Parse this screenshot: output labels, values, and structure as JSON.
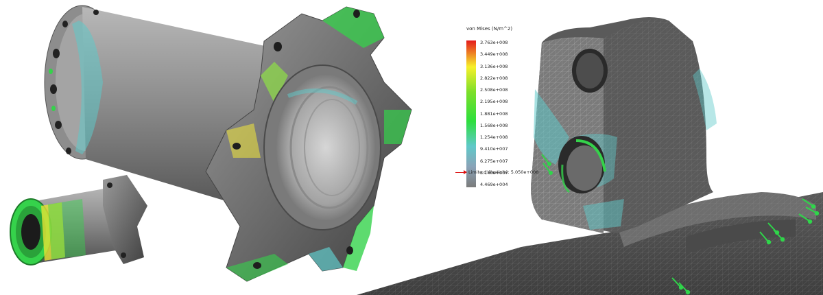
{
  "legend": {
    "title": "von Mises (N/m^2)",
    "ticks": [
      "3.763e+008",
      "3.449e+008",
      "3.136e+008",
      "2.822e+008",
      "2.508e+008",
      "2.195e+008",
      "1.881e+008",
      "1.568e+008",
      "1.254e+008",
      "9.410e+007",
      "6.275e+007",
      "3.140e+007",
      "4.469e+004"
    ],
    "yield_label": "Limite d'élasticité: 5.050e+008"
  },
  "colors": {
    "max": "#e41a1c",
    "high": "#f7f02a",
    "mid": "#2ddf3d",
    "low": "#5fc9c9",
    "min": "#7b7b7b"
  }
}
